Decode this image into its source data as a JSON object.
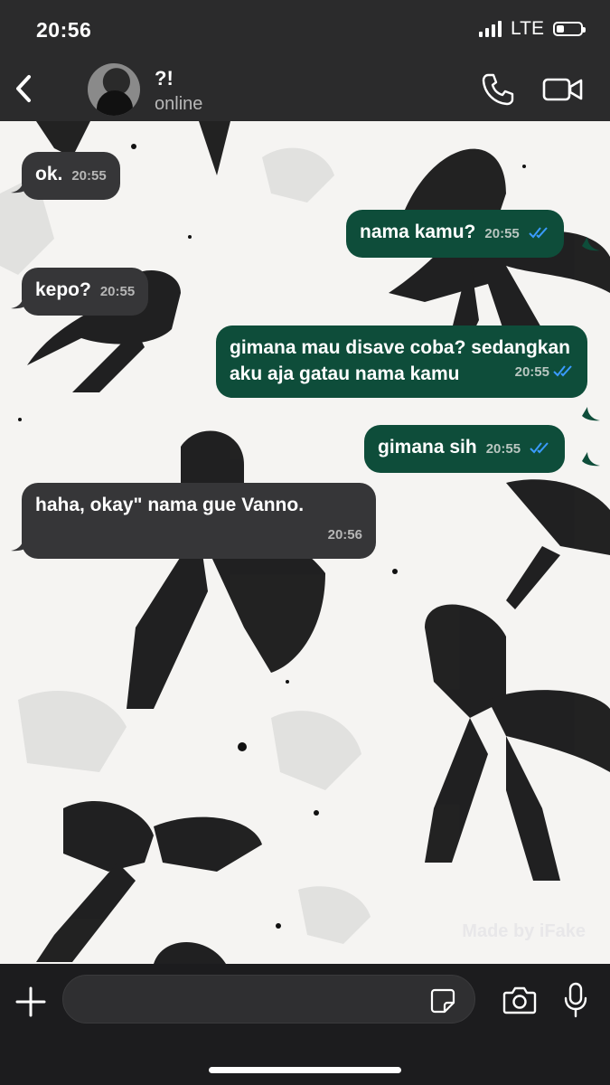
{
  "status_bar": {
    "time": "20:56",
    "network": "LTE",
    "battery_level": 0.3
  },
  "header": {
    "contact_name": "?!",
    "contact_status": "online"
  },
  "messages": [
    {
      "direction": "in",
      "text": "ok.",
      "time": "20:55"
    },
    {
      "direction": "out",
      "text": "nama kamu?",
      "time": "20:55",
      "read": true
    },
    {
      "direction": "in",
      "text": "kepo?",
      "time": "20:55"
    },
    {
      "direction": "out",
      "text": "gimana mau disave coba? sedangkan aku aja gatau nama kamu",
      "time": "20:55",
      "read": true
    },
    {
      "direction": "out",
      "text": "gimana sih",
      "time": "20:55",
      "read": true
    },
    {
      "direction": "in",
      "text": "haha, okay\" nama gue Vanno.",
      "time": "20:56"
    }
  ],
  "watermark": "Made by iFake",
  "composer": {
    "input_value": ""
  },
  "icons": [
    "chevron-left-icon",
    "phone-icon",
    "video-camera-icon",
    "plus-icon",
    "sticker-icon",
    "camera-icon",
    "microphone-icon"
  ],
  "colors": {
    "incoming_bubble": "#363638",
    "outgoing_bubble": "#0e4d3a",
    "read_ticks": "#3a9bff"
  }
}
